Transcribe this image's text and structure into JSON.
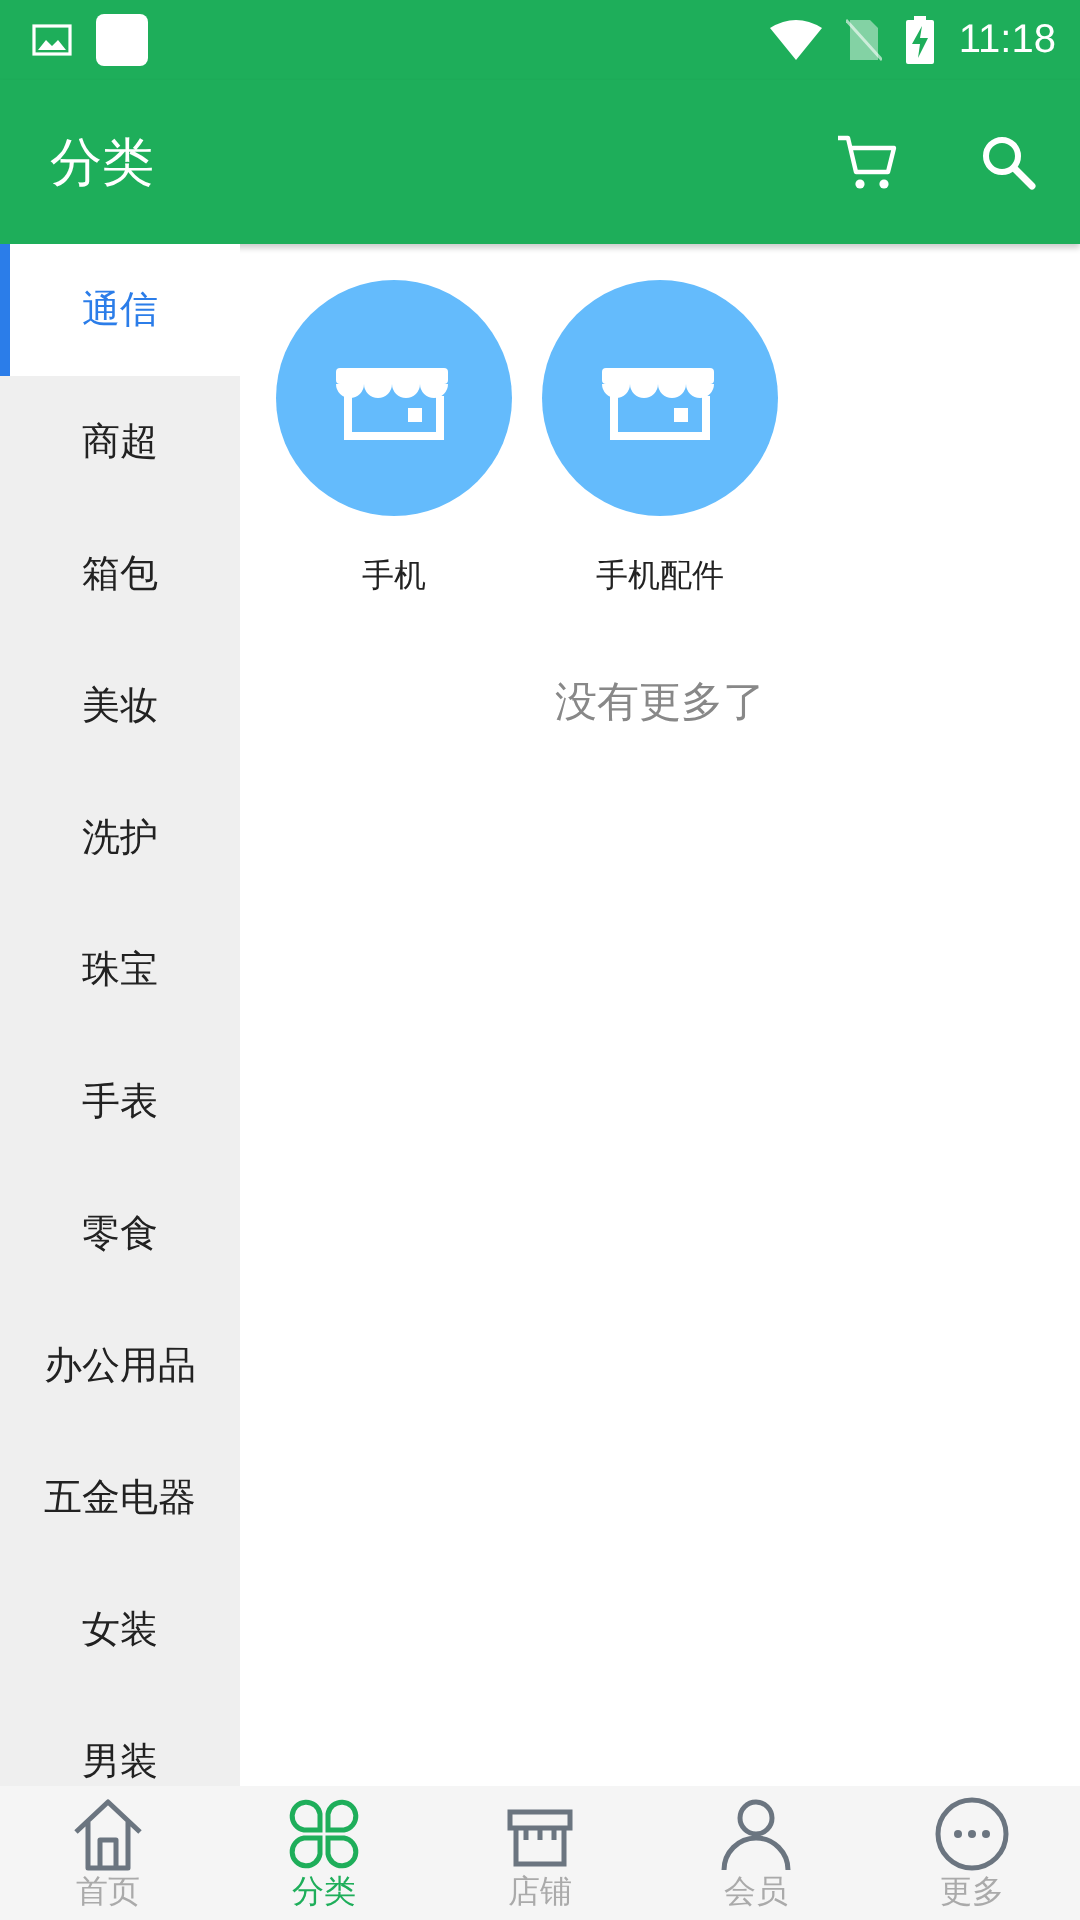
{
  "status_bar": {
    "time": "11:18"
  },
  "app_bar": {
    "title": "分类"
  },
  "sidebar": {
    "items": [
      {
        "label": "通信",
        "selected": true
      },
      {
        "label": "商超",
        "selected": false
      },
      {
        "label": "箱包",
        "selected": false
      },
      {
        "label": "美妆",
        "selected": false
      },
      {
        "label": "洗护",
        "selected": false
      },
      {
        "label": "珠宝",
        "selected": false
      },
      {
        "label": "手表",
        "selected": false
      },
      {
        "label": "零食",
        "selected": false
      },
      {
        "label": "办公用品",
        "selected": false
      },
      {
        "label": "五金电器",
        "selected": false
      },
      {
        "label": "女装",
        "selected": false
      },
      {
        "label": "男装",
        "selected": false
      }
    ]
  },
  "categories": [
    {
      "label": "手机"
    },
    {
      "label": "手机配件"
    }
  ],
  "end_note": "没有更多了",
  "bottom_nav": [
    {
      "label": "首页",
      "kind": "home",
      "selected": false
    },
    {
      "label": "分类",
      "kind": "category",
      "selected": true
    },
    {
      "label": "店铺",
      "kind": "store",
      "selected": false
    },
    {
      "label": "会员",
      "kind": "member",
      "selected": false
    },
    {
      "label": "更多",
      "kind": "more",
      "selected": false
    }
  ]
}
